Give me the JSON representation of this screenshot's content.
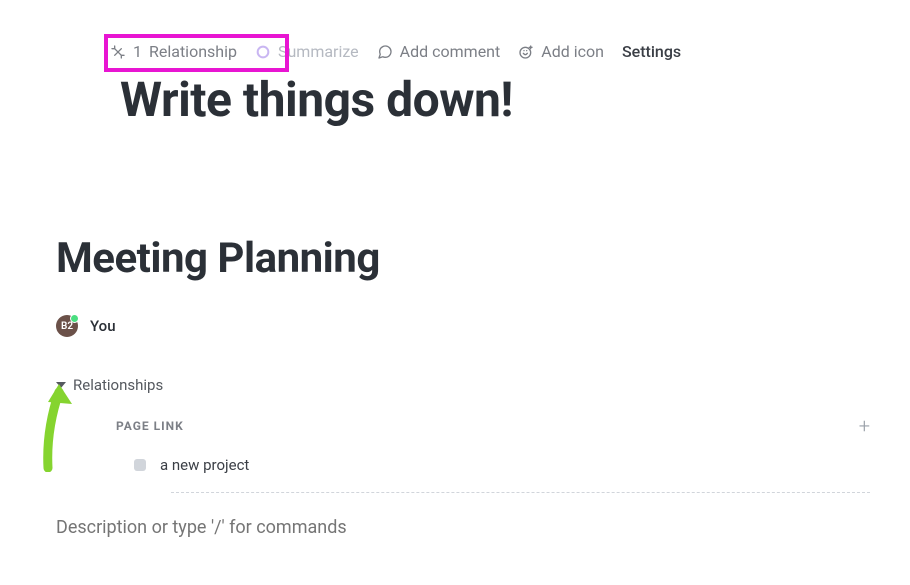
{
  "toolbar": {
    "relationship": {
      "count": "1",
      "label": "Relationship"
    },
    "summarize_label": "Summarize",
    "add_comment_label": "Add comment",
    "add_icon_label": "Add icon",
    "settings_label": "Settings"
  },
  "big_title": "Write things down!",
  "page_title": "Meeting Planning",
  "author": {
    "avatar_initials": "B2",
    "name": "You"
  },
  "relationships": {
    "header": "Relationships",
    "page_link_label": "PAGE LINK",
    "items": [
      {
        "label": "a new project"
      }
    ]
  },
  "description_placeholder": "Description or type '/' for commands"
}
